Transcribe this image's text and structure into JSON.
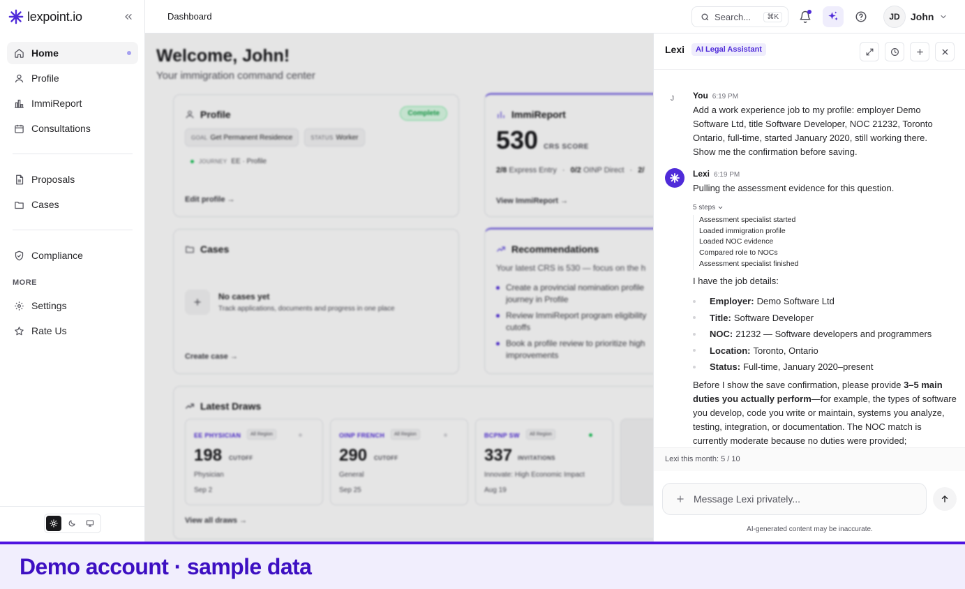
{
  "brand": {
    "name": "lexpoint.io"
  },
  "sidebar": {
    "items": [
      {
        "label": "Home"
      },
      {
        "label": "Profile"
      },
      {
        "label": "ImmiReport"
      },
      {
        "label": "Consultations"
      },
      {
        "label": "Proposals"
      },
      {
        "label": "Cases"
      },
      {
        "label": "Compliance"
      }
    ],
    "more_label": "MORE",
    "more_items": [
      {
        "label": "Settings"
      },
      {
        "label": "Rate Us"
      }
    ]
  },
  "header": {
    "title": "Dashboard",
    "search_label": "Search...",
    "search_shortcut": "⌘K",
    "user_initials": "JD",
    "user_name": "John"
  },
  "dashboard": {
    "welcome": "Welcome, John!",
    "subtitle": "Your immigration command center",
    "profile_card": {
      "title": "Profile",
      "status": "Complete",
      "goal_key": "GOAL",
      "goal_value": "Get Permanent Residence",
      "status_key": "STATUS",
      "status_value": "Worker",
      "journey_key": "JOURNEY",
      "journey_value": "EE · Profile",
      "link": "Edit profile →"
    },
    "immireport_card": {
      "title": "ImmiReport",
      "score": "530",
      "score_label": "CRS SCORE",
      "ee_count": "2/8",
      "ee_label": "Express Entry",
      "oinp_count": "0/2",
      "oinp_label": "OINP Direct",
      "extra_count": "2/",
      "link": "View ImmiReport →"
    },
    "cases_card": {
      "title": "Cases",
      "empty_title": "No cases yet",
      "empty_desc": "Track applications, documents and progress in one place",
      "link": "Create case →"
    },
    "recommendations_card": {
      "title": "Recommendations",
      "intro": "Your latest CRS is 530 — focus on the h",
      "items": [
        {
          "line1": "Create a provincial nomination profile",
          "line2": "journey in Profile"
        },
        {
          "line1": "Review ImmiReport program eligibility",
          "line2": "cutoffs"
        },
        {
          "line1": "Book a profile review to prioritize high",
          "line2": "improvements"
        }
      ]
    },
    "draws": {
      "title": "Latest Draws",
      "link": "View all draws →",
      "cards": [
        {
          "tag": "EE PHYSICIAN",
          "region": "All Region",
          "number": "198",
          "kind": "CUTOFF",
          "desc": "Physician",
          "date": "Sep 2",
          "dot_color": "#d4d4d8"
        },
        {
          "tag": "OINP FRENCH",
          "region": "All Region",
          "number": "290",
          "kind": "CUTOFF",
          "desc": "General",
          "date": "Sep 25",
          "dot_color": "#d4d4d8"
        },
        {
          "tag": "BCPNP SW",
          "region": "All Region",
          "number": "337",
          "kind": "INVITATIONS",
          "desc": "Innovate: High Economic Impact",
          "date": "Aug 19",
          "dot_color": "#22c55e"
        }
      ]
    }
  },
  "lexi": {
    "title": "Lexi",
    "badge": "AI Legal Assistant",
    "user_msg": {
      "avatar": "J",
      "author": "You",
      "time": "6:19 PM",
      "lines": [
        "Add a work experience job to my profile: employer Demo",
        "Software Ltd, title Software Developer, NOC 21232, Toronto",
        "Ontario, full-time, started January 2020, still working there.",
        "Show me the confirmation before saving."
      ]
    },
    "bot_msg": {
      "author": "Lexi",
      "time": "6:19 PM",
      "intro": "Pulling the assessment evidence for this question.",
      "steps_toggle": "5 steps",
      "steps": [
        "Assessment specialist started",
        "Loaded immigration profile",
        "Loaded NOC evidence",
        "Compared role to NOCs",
        "Assessment specialist finished"
      ],
      "details_intro": "I have the job details:",
      "details": [
        {
          "k": "Employer:",
          "v": "Demo Software Ltd"
        },
        {
          "k": "Title:",
          "v": "Software Developer"
        },
        {
          "k": "NOC:",
          "v": "21232 — Software developers and programmers"
        },
        {
          "k": "Location:",
          "v": "Toronto, Ontario"
        },
        {
          "k": "Status:",
          "v": "Full-time, January 2020–present"
        }
      ],
      "closing_a": "Before I show the save confirmation, please provide ",
      "closing_bold": "3–5 main duties you actually perform",
      "closing_b": "—for example, the types of software you develop, code you write or maintain, systems you analyze, testing, integration, or documentation. The NOC match is currently moderate because no duties were provided;"
    },
    "usage": "Lexi this month: 5 / 10",
    "composer_placeholder": "Message Lexi privately...",
    "disclaimer": "AI-generated content may be inaccurate."
  },
  "banner": {
    "text": "Demo account · sample data"
  }
}
